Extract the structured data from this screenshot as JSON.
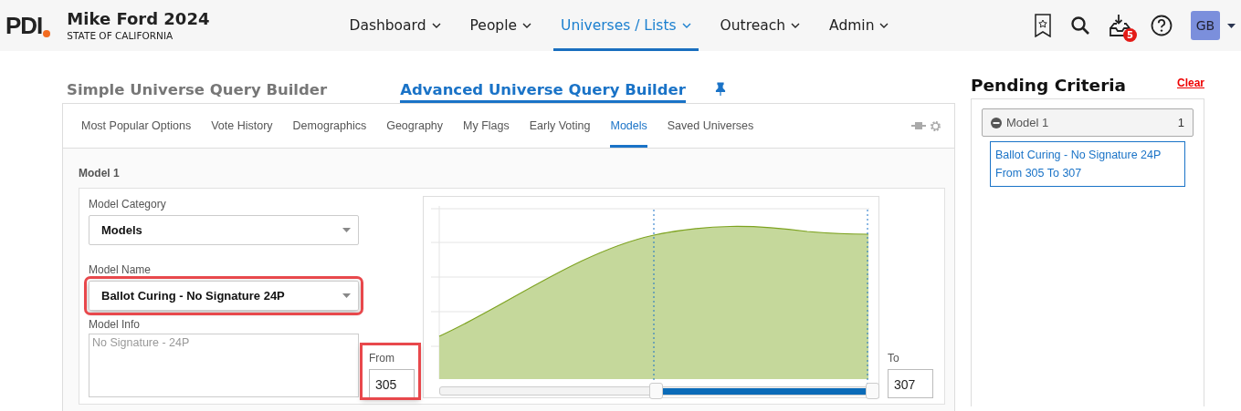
{
  "header": {
    "logo": "PDI",
    "campaign": "Mike Ford 2024",
    "state": "STATE OF CALIFORNIA",
    "nav": [
      {
        "label": "Dashboard",
        "selected": false
      },
      {
        "label": "People",
        "selected": false
      },
      {
        "label": "Universes / Lists",
        "selected": true
      },
      {
        "label": "Outreach",
        "selected": false
      },
      {
        "label": "Admin",
        "selected": false
      }
    ],
    "notification_count": "5",
    "avatar": "GB"
  },
  "builder_tabs": [
    {
      "label": "Simple Universe Query Builder",
      "selected": false
    },
    {
      "label": "Advanced Universe Query Builder",
      "selected": true
    }
  ],
  "sub_tabs": [
    {
      "label": "Most Popular Options",
      "selected": false
    },
    {
      "label": "Vote History",
      "selected": false
    },
    {
      "label": "Demographics",
      "selected": false
    },
    {
      "label": "Geography",
      "selected": false
    },
    {
      "label": "My Flags",
      "selected": false
    },
    {
      "label": "Early Voting",
      "selected": false
    },
    {
      "label": "Models",
      "selected": true
    },
    {
      "label": "Saved Universes",
      "selected": false
    }
  ],
  "section_title": "Model 1",
  "model_category": {
    "label": "Model Category",
    "value": "Models",
    "highlighted": false
  },
  "model_name": {
    "label": "Model Name",
    "value": "Ballot Curing - No Signature 24P",
    "highlighted": true
  },
  "model_info": {
    "label": "Model Info",
    "placeholder": "No Signature - 24P"
  },
  "from": {
    "label": "From",
    "value": "305",
    "highlighted": true
  },
  "to": {
    "label": "To",
    "value": "307",
    "highlighted": false
  },
  "range_slider": {
    "level": 0.5
  },
  "pending": {
    "title": "Pending Criteria",
    "clear": "Clear",
    "group": "Model 1",
    "group_count": "1",
    "criteria": [
      "Ballot Curing - No Signature 24P",
      "From 305 To 307"
    ]
  }
}
